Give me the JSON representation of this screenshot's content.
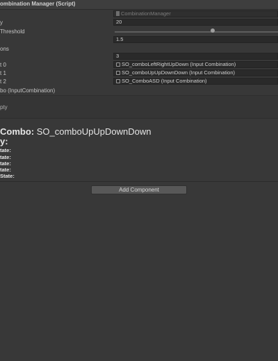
{
  "component": {
    "title": "ombination Manager (Script)"
  },
  "fields": [
    {
      "label": "",
      "value": "CombinationManager",
      "kind": "script"
    },
    {
      "label": "y",
      "value": "20",
      "kind": "number"
    },
    {
      "label": "Threshold",
      "value": "",
      "kind": "slider",
      "slider_fraction": 0.6
    },
    {
      "label": "",
      "value": "1.5",
      "kind": "number"
    },
    {
      "label": "ons",
      "value": "",
      "kind": "blank"
    },
    {
      "label": "",
      "value": "3",
      "kind": "number"
    },
    {
      "label": "t 0",
      "value": "SO_comboLeftRightUpDown (Input Combination)",
      "kind": "ref"
    },
    {
      "label": "t 1",
      "value": "SO_comboUpUpDownDown (Input Combination)",
      "kind": "ref"
    },
    {
      "label": "t 2",
      "value": "SO_ComboASD (Input Combination)",
      "kind": "ref"
    },
    {
      "label": "bo (InputCombination)",
      "value": "",
      "kind": "blank"
    }
  ],
  "section": {
    "label": "pty"
  },
  "debug": {
    "combo_label": "Combo:",
    "combo_value": "SO_comboUpUpDownDown",
    "history_title": "y:",
    "states": [
      {
        "label": "tate:",
        "value": "",
        "color": "#3c8a3c"
      },
      {
        "label": "tate:",
        "value": "",
        "color": "#b33a3a"
      },
      {
        "label": "tate:",
        "value": "",
        "color": "#3c8a3c"
      },
      {
        "label": "tate:",
        "value": "",
        "color": "#b33a3a"
      },
      {
        "label": "State:",
        "value": "",
        "color": "#3c8a3c"
      }
    ]
  },
  "add_component": {
    "label": "Add Component"
  }
}
